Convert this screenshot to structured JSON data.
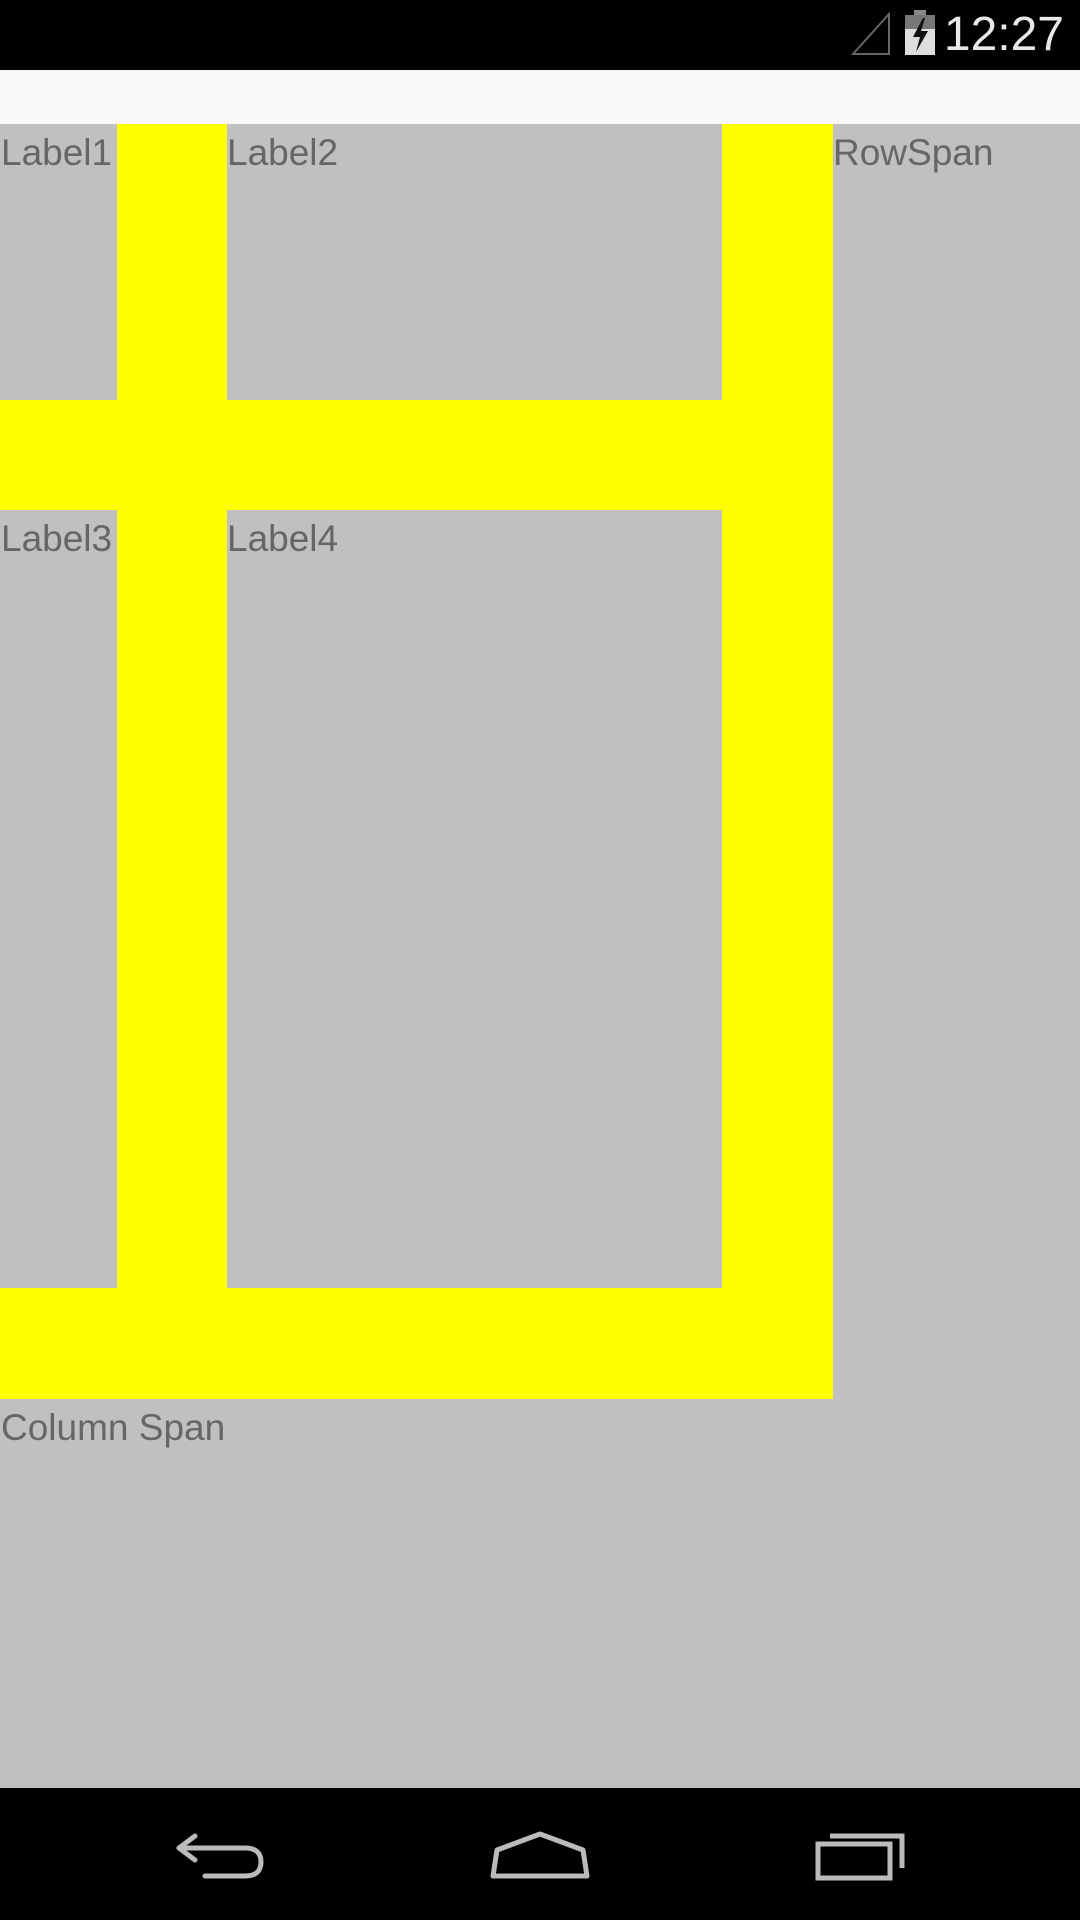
{
  "status_bar": {
    "time": "12:27",
    "icons": [
      "signal-icon",
      "battery-charging-icon"
    ]
  },
  "grid": {
    "labels": {
      "label1": "Label1",
      "label2": "Label2",
      "label3": "Label3",
      "label4": "Label4",
      "row_span": "RowSpan",
      "column_span": "Column Span"
    },
    "colors": {
      "cell_background": "#c0c0c0",
      "spacer": "#ffff00",
      "label_text": "#666666"
    }
  },
  "nav_bar": {
    "buttons": [
      "back-icon",
      "home-icon",
      "recents-icon"
    ]
  }
}
